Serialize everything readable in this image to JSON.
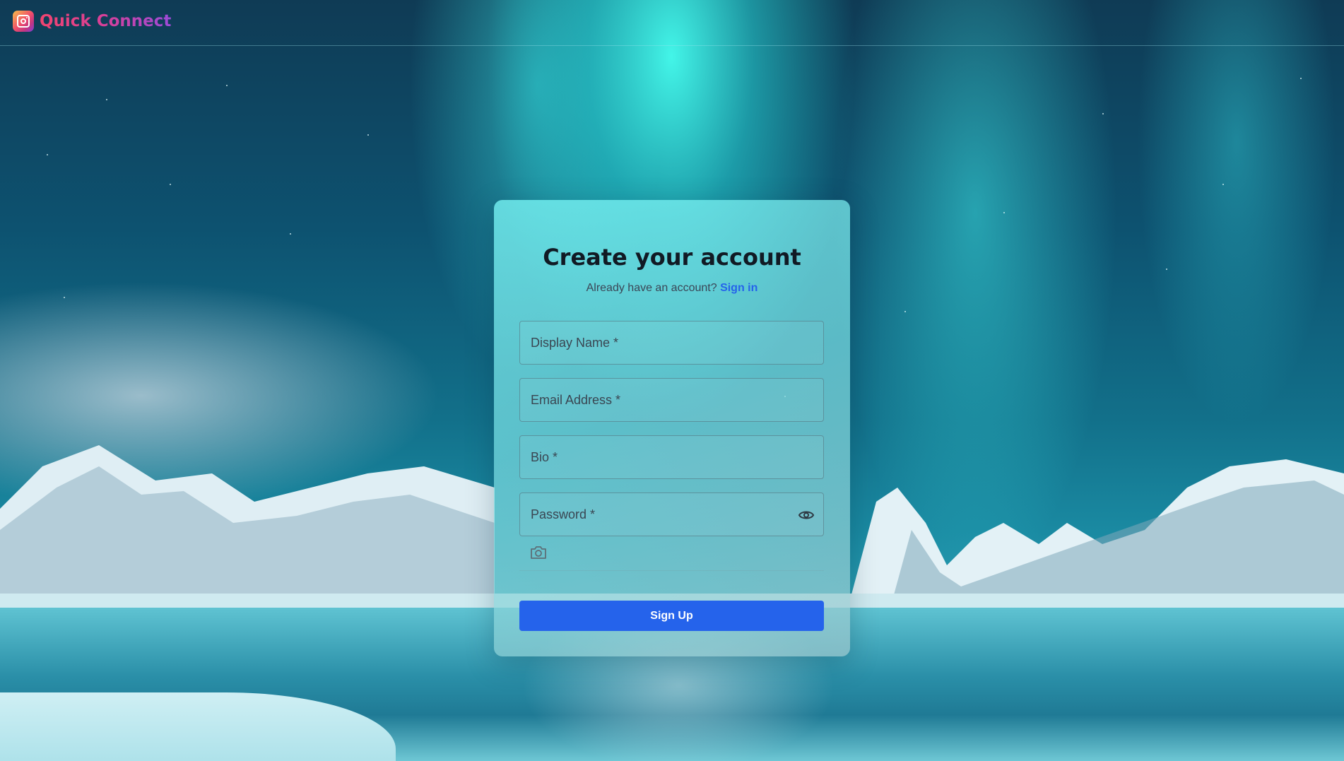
{
  "app": {
    "name": "Quick Connect",
    "logo_icon": "instagram-icon",
    "brand_colors": [
      "#f0446f",
      "#d7409a",
      "#9d4bd8"
    ]
  },
  "form": {
    "title": "Create your account",
    "subtitle_text": "Already have an account?",
    "sign_in_link": "Sign in",
    "fields": {
      "display_name": {
        "placeholder": "Display Name *",
        "value": ""
      },
      "email": {
        "placeholder": "Email Address *",
        "value": ""
      },
      "bio": {
        "placeholder": "Bio *",
        "value": ""
      },
      "password": {
        "placeholder": "Password *",
        "value": ""
      }
    },
    "password_toggle_icon": "eye-icon",
    "photo_upload_icon": "camera-icon",
    "submit_label": "Sign Up",
    "accent_color": "#2563eb"
  }
}
